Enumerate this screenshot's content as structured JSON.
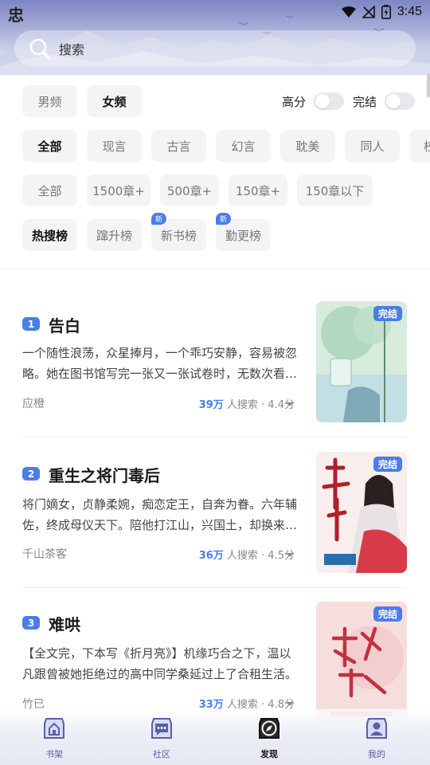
{
  "status_bar": {
    "app_glyph": "忠",
    "time": "3:45"
  },
  "search": {
    "placeholder": "搜索"
  },
  "gender_tabs": [
    {
      "label": "男频",
      "active": false
    },
    {
      "label": "女频",
      "active": true
    }
  ],
  "toggles": [
    {
      "label": "高分",
      "on": false
    },
    {
      "label": "完结",
      "on": false
    }
  ],
  "categories": [
    "全部",
    "现言",
    "古言",
    "幻言",
    "耽美",
    "同人",
    "校"
  ],
  "chapter_filters": [
    "全部",
    "1500章+",
    "500章+",
    "150章+",
    "150章以下"
  ],
  "rank_tabs": [
    {
      "label": "热搜榜",
      "active": true,
      "badge": ""
    },
    {
      "label": "蹿升榜",
      "active": false,
      "badge": ""
    },
    {
      "label": "新书榜",
      "active": false,
      "badge": "新"
    },
    {
      "label": "勤更榜",
      "active": false,
      "badge": "新"
    }
  ],
  "books": [
    {
      "rank": "1",
      "title": "告白",
      "desc": "一个随性浪荡，众星捧月，一个乖巧安静，容易被忽略。她在图书馆写完一张又一张试卷时，无数次看着他从门口经过。",
      "author": "应橙",
      "hits": "39万",
      "stats_suffix": " 人搜索 · 4.4分",
      "status": "完结",
      "cover_colors": [
        "#cfe9d8",
        "#9cc8b4"
      ]
    },
    {
      "rank": "2",
      "title": "重生之将门毒后",
      "desc": "将门嫡女，贞静柔婉，痴恋定王，自奔为眷。六年辅佐，终成母仪天下。陪他打江山，兴国土，却换来满门抄斩。",
      "author": "千山茶客",
      "hits": "36万",
      "stats_suffix": " 人搜索 · 4.5分",
      "status": "完结",
      "cover_colors": [
        "#f7e9ea",
        "#d9434f"
      ]
    },
    {
      "rank": "3",
      "title": "难哄",
      "desc": "【全文完，下本写《折月亮》】机缘巧合之下，温以凡跟曾被她拒绝过的高中同学桑延过上了合租生活。",
      "author": "竹已",
      "hits": "33万",
      "stats_suffix": " 人搜索 · 4.8分",
      "status": "完结",
      "cover_colors": [
        "#f6dcdc",
        "#e7a0a4"
      ]
    }
  ],
  "bottom_nav": [
    {
      "label": "书架",
      "icon": "house-icon",
      "active": false
    },
    {
      "label": "社区",
      "icon": "chat-bubble-icon",
      "active": false
    },
    {
      "label": "发现",
      "icon": "compass-icon",
      "active": true
    },
    {
      "label": "我的",
      "icon": "person-icon",
      "active": false
    }
  ],
  "colors": {
    "accent": "#4a7ee6",
    "chip_bg": "#f4f4f6",
    "nav_label": "#5a5fa8"
  }
}
